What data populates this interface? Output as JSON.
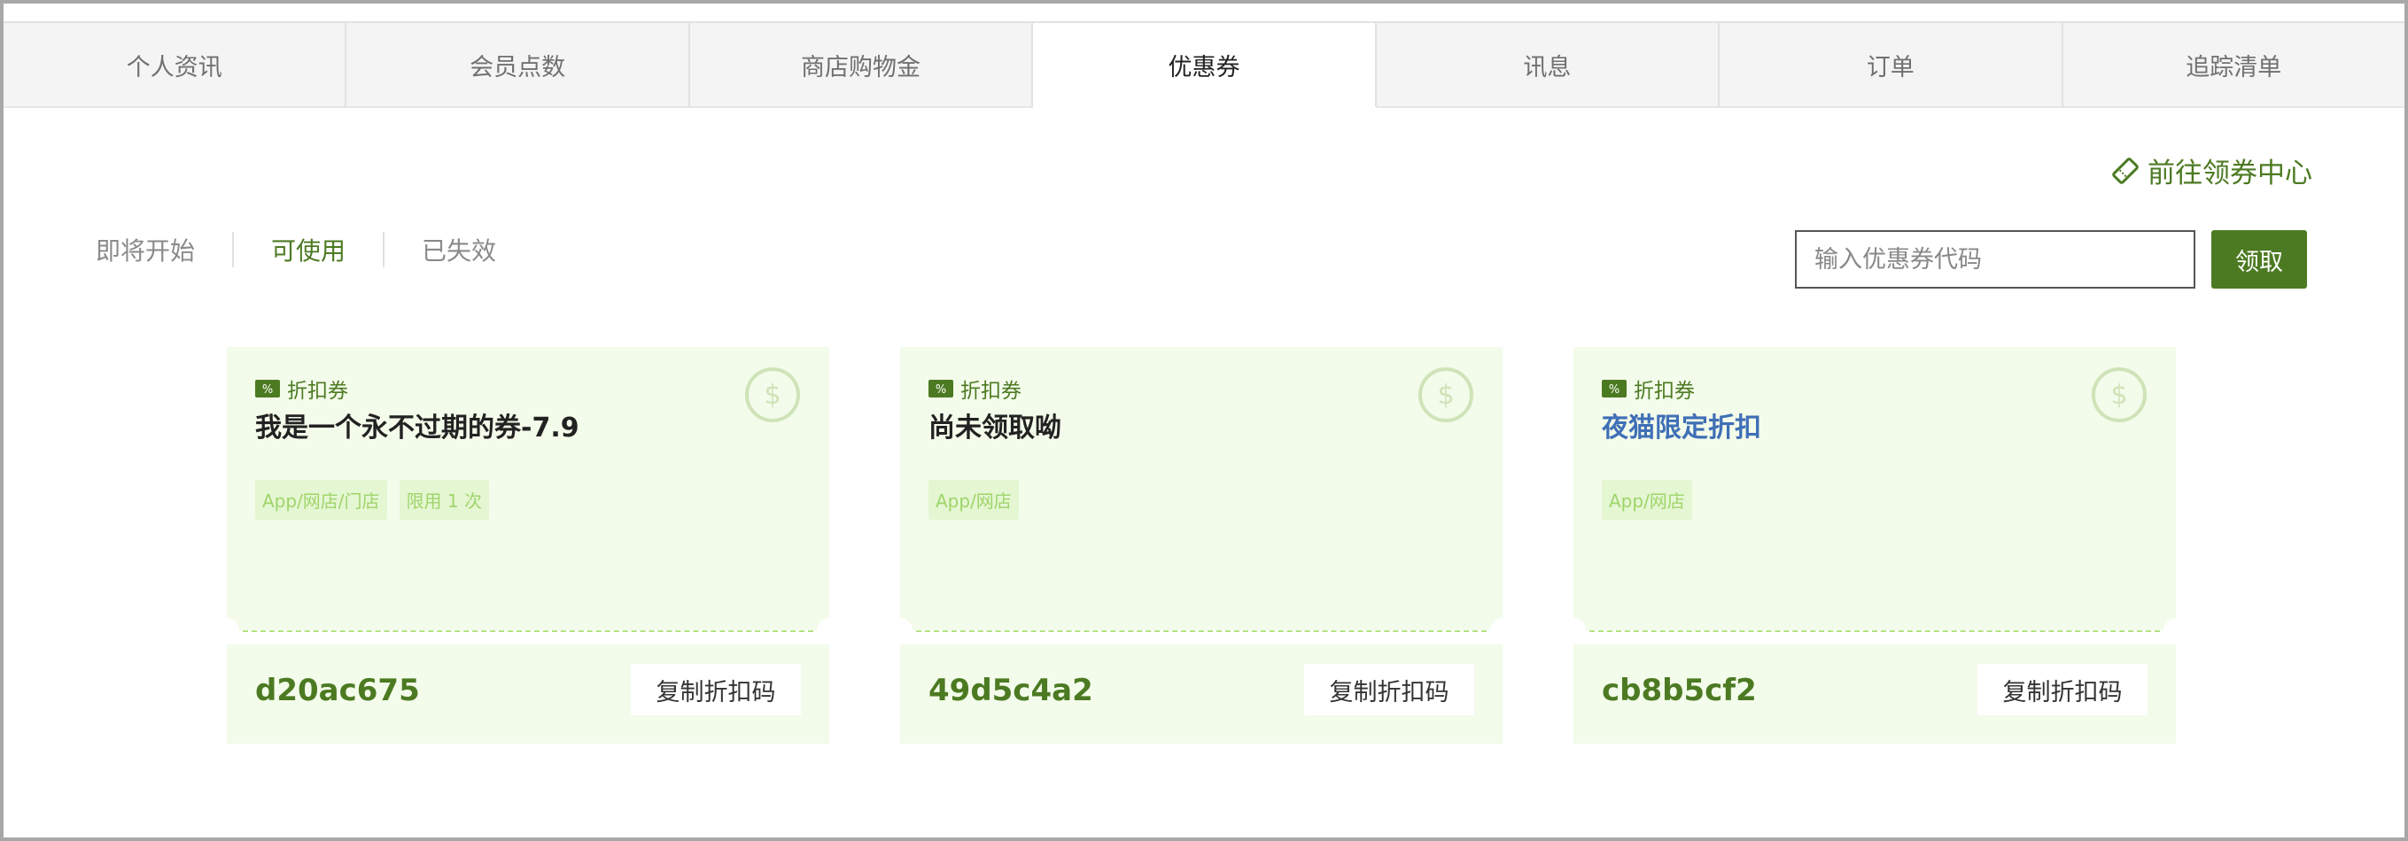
{
  "tabs": [
    {
      "label": "个人资讯"
    },
    {
      "label": "会员点数"
    },
    {
      "label": "商店购物金"
    },
    {
      "label": "优惠券"
    },
    {
      "label": "讯息"
    },
    {
      "label": "订单"
    },
    {
      "label": "追踪清单"
    }
  ],
  "active_tab": "优惠券",
  "coupon_center_link": {
    "label": "前往领券中心",
    "icon": "ticket-icon"
  },
  "filters": [
    {
      "label": "即将开始"
    },
    {
      "label": "可使用"
    },
    {
      "label": "已失效"
    }
  ],
  "active_filter": "可使用",
  "code_input": {
    "placeholder": "输入优惠券代码",
    "value": ""
  },
  "claim_button": {
    "label": "领取"
  },
  "colors": {
    "accent": "#4c7a22",
    "card_bg": "#f3fbea",
    "tag_text": "#9fd56a",
    "link_blue": "#3f6fb6"
  },
  "coupons": [
    {
      "type": "折扣券",
      "title": "我是一个永不过期的券-7.9",
      "tags": [
        "App/网店/门店",
        "限用 1 次"
      ],
      "code": "d20ac675",
      "copy_label": "复制折扣码"
    },
    {
      "type": "折扣券",
      "title": "尚未领取呦",
      "tags": [
        "App/网店"
      ],
      "code": "49d5c4a2",
      "copy_label": "复制折扣码"
    },
    {
      "type": "折扣券",
      "title": "夜猫限定折扣",
      "tags": [
        "App/网店"
      ],
      "code": "cb8b5cf2",
      "copy_label": "复制折扣码"
    }
  ]
}
